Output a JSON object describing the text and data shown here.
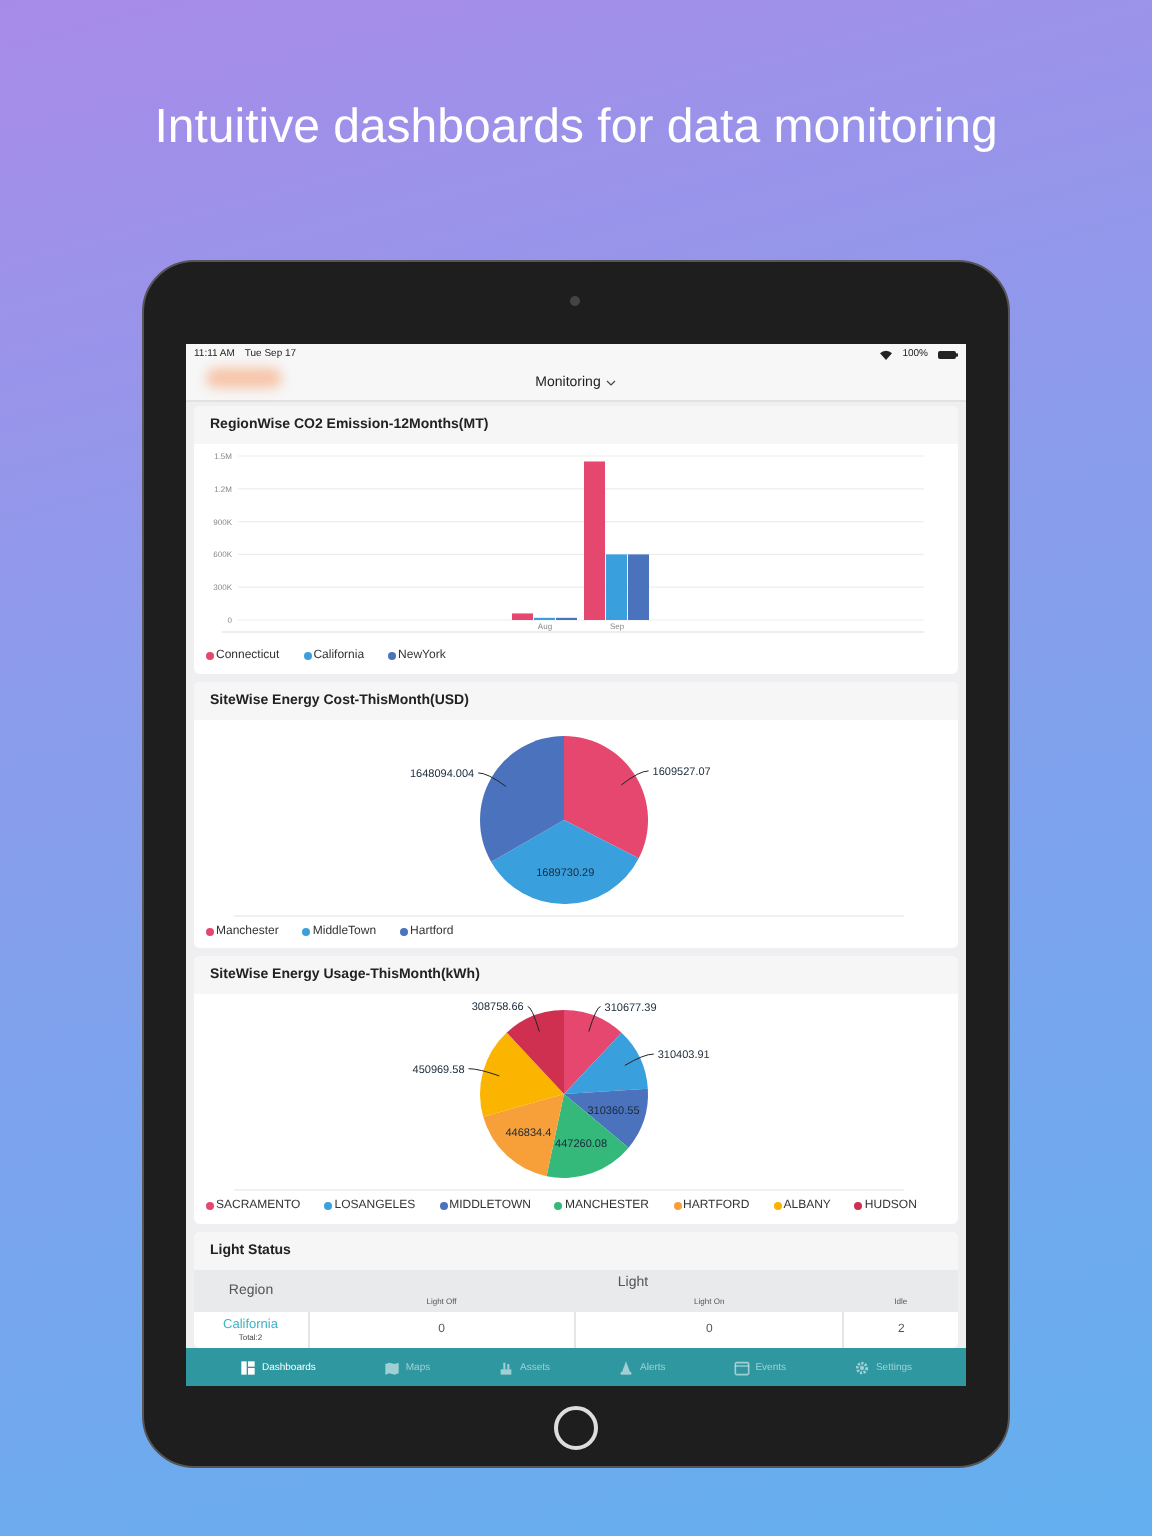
{
  "headline": "Intuitive dashboards for data monitoring",
  "status_bar": {
    "time": "11:11 AM",
    "date": "Tue Sep 17",
    "battery": "100%"
  },
  "nav": {
    "title": "Monitoring"
  },
  "charts": [
    {
      "chart_data": {
        "type": "bar",
        "title": "RegionWise CO2 Emission-12Months(MT)",
        "categories": [
          "Aug",
          "Sep"
        ],
        "grid": true,
        "ylim": [
          0,
          1500000
        ],
        "yticks": [
          {
            "value": 1500000,
            "label": "1.5M"
          },
          {
            "value": 1200000,
            "label": "1.2M"
          },
          {
            "value": 900000,
            "label": "900K"
          },
          {
            "value": 600000,
            "label": "600K"
          },
          {
            "value": 300000,
            "label": "300K"
          },
          {
            "value": 0,
            "label": "0"
          }
        ],
        "series": [
          {
            "name": "Connecticut",
            "color": "#e5476f",
            "values": [
              60000,
              1450000
            ]
          },
          {
            "name": "California",
            "color": "#3aa0dd",
            "values": [
              20000,
              600000
            ]
          },
          {
            "name": "NewYork",
            "color": "#4a72bd",
            "values": [
              20000,
              600000
            ]
          }
        ]
      }
    },
    {
      "chart_data": {
        "type": "pie",
        "title": "SiteWise Energy Cost-ThisMonth(USD)",
        "categories": [
          "Manchester",
          "MiddleTown",
          "Hartford"
        ],
        "values": [
          1609527.07,
          1689730.29,
          1648094.004
        ],
        "colors": [
          "#e5476f",
          "#3aa0dd",
          "#4a72bd"
        ],
        "value_labels": [
          "1609527.07",
          "1689730.29",
          "1648094.004"
        ]
      }
    },
    {
      "chart_data": {
        "type": "pie",
        "title": "SiteWise Energy Usage-ThisMonth(kWh)",
        "categories": [
          "SACRAMENTO",
          "LOSANGELES",
          "MIDDLETOWN",
          "MANCHESTER",
          "HARTFORD",
          "ALBANY",
          "HUDSON"
        ],
        "values": [
          310677.39,
          310403.91,
          310360.55,
          447260.08,
          446834.4,
          450969.58,
          308758.66
        ],
        "colors": [
          "#e5476f",
          "#3aa0dd",
          "#4a72bd",
          "#35b97a",
          "#f7a03a",
          "#fbb500",
          "#d03050"
        ],
        "value_labels": [
          "310677.39",
          "310403.91",
          "310360.55",
          "447260.08",
          "446834.4",
          "450969.58",
          "308758.66"
        ]
      }
    }
  ],
  "table": {
    "title": "Light Status",
    "region_header": "Region",
    "group_header": "Light",
    "columns": [
      "Light Off",
      "Light On",
      "Idle"
    ],
    "rows": [
      {
        "region": "California",
        "total": "Total:2",
        "cells": [
          "0",
          "0",
          "2"
        ]
      }
    ]
  },
  "tabs": [
    {
      "label": "Dashboards",
      "selected": true
    },
    {
      "label": "Maps",
      "selected": false
    },
    {
      "label": "Assets",
      "selected": false
    },
    {
      "label": "Alerts",
      "selected": false
    },
    {
      "label": "Events",
      "selected": false
    },
    {
      "label": "Settings",
      "selected": false
    }
  ]
}
